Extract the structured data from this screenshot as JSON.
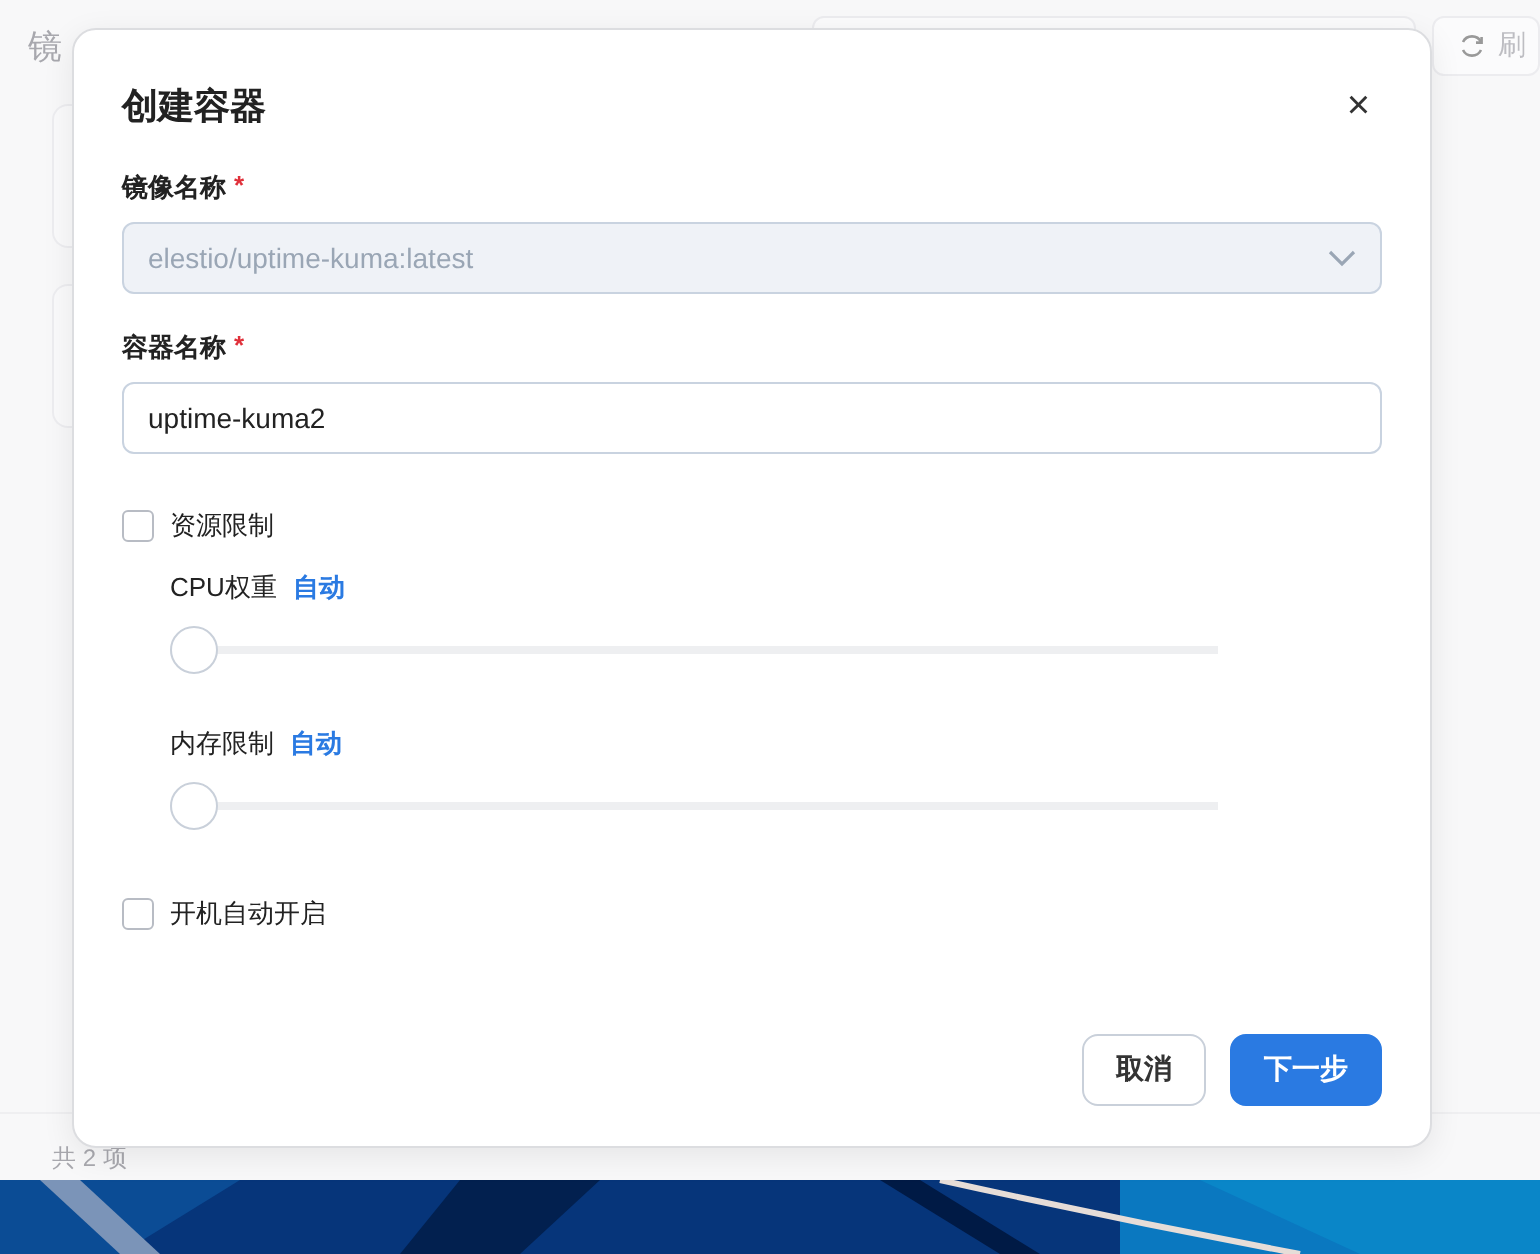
{
  "background": {
    "title": "镜",
    "refresh_button": "刷",
    "footer": "共 2 项"
  },
  "dialog": {
    "title": "创建容器",
    "close": "×",
    "fields": [
      {
        "kind": "select",
        "label": "镜像名称",
        "required_mark": "*",
        "value": "elestio/uptime-kuma:latest",
        "disabled": true
      },
      {
        "kind": "text",
        "label": "容器名称",
        "required_mark": "*",
        "value": "uptime-kuma2",
        "disabled": false
      }
    ],
    "options": [
      {
        "kind": "checkbox",
        "label": "资源限制",
        "checked": false
      },
      {
        "kind": "slider",
        "label": "CPU权重",
        "reading": "自动",
        "level": 0
      },
      {
        "kind": "slider",
        "label": "内存限制",
        "reading": "自动",
        "level": 0
      },
      {
        "kind": "checkbox",
        "label": "开机自动开启",
        "checked": false
      }
    ],
    "buttons": [
      {
        "label": "取消",
        "kind": "secondary"
      },
      {
        "label": "下一步",
        "kind": "primary"
      }
    ]
  }
}
